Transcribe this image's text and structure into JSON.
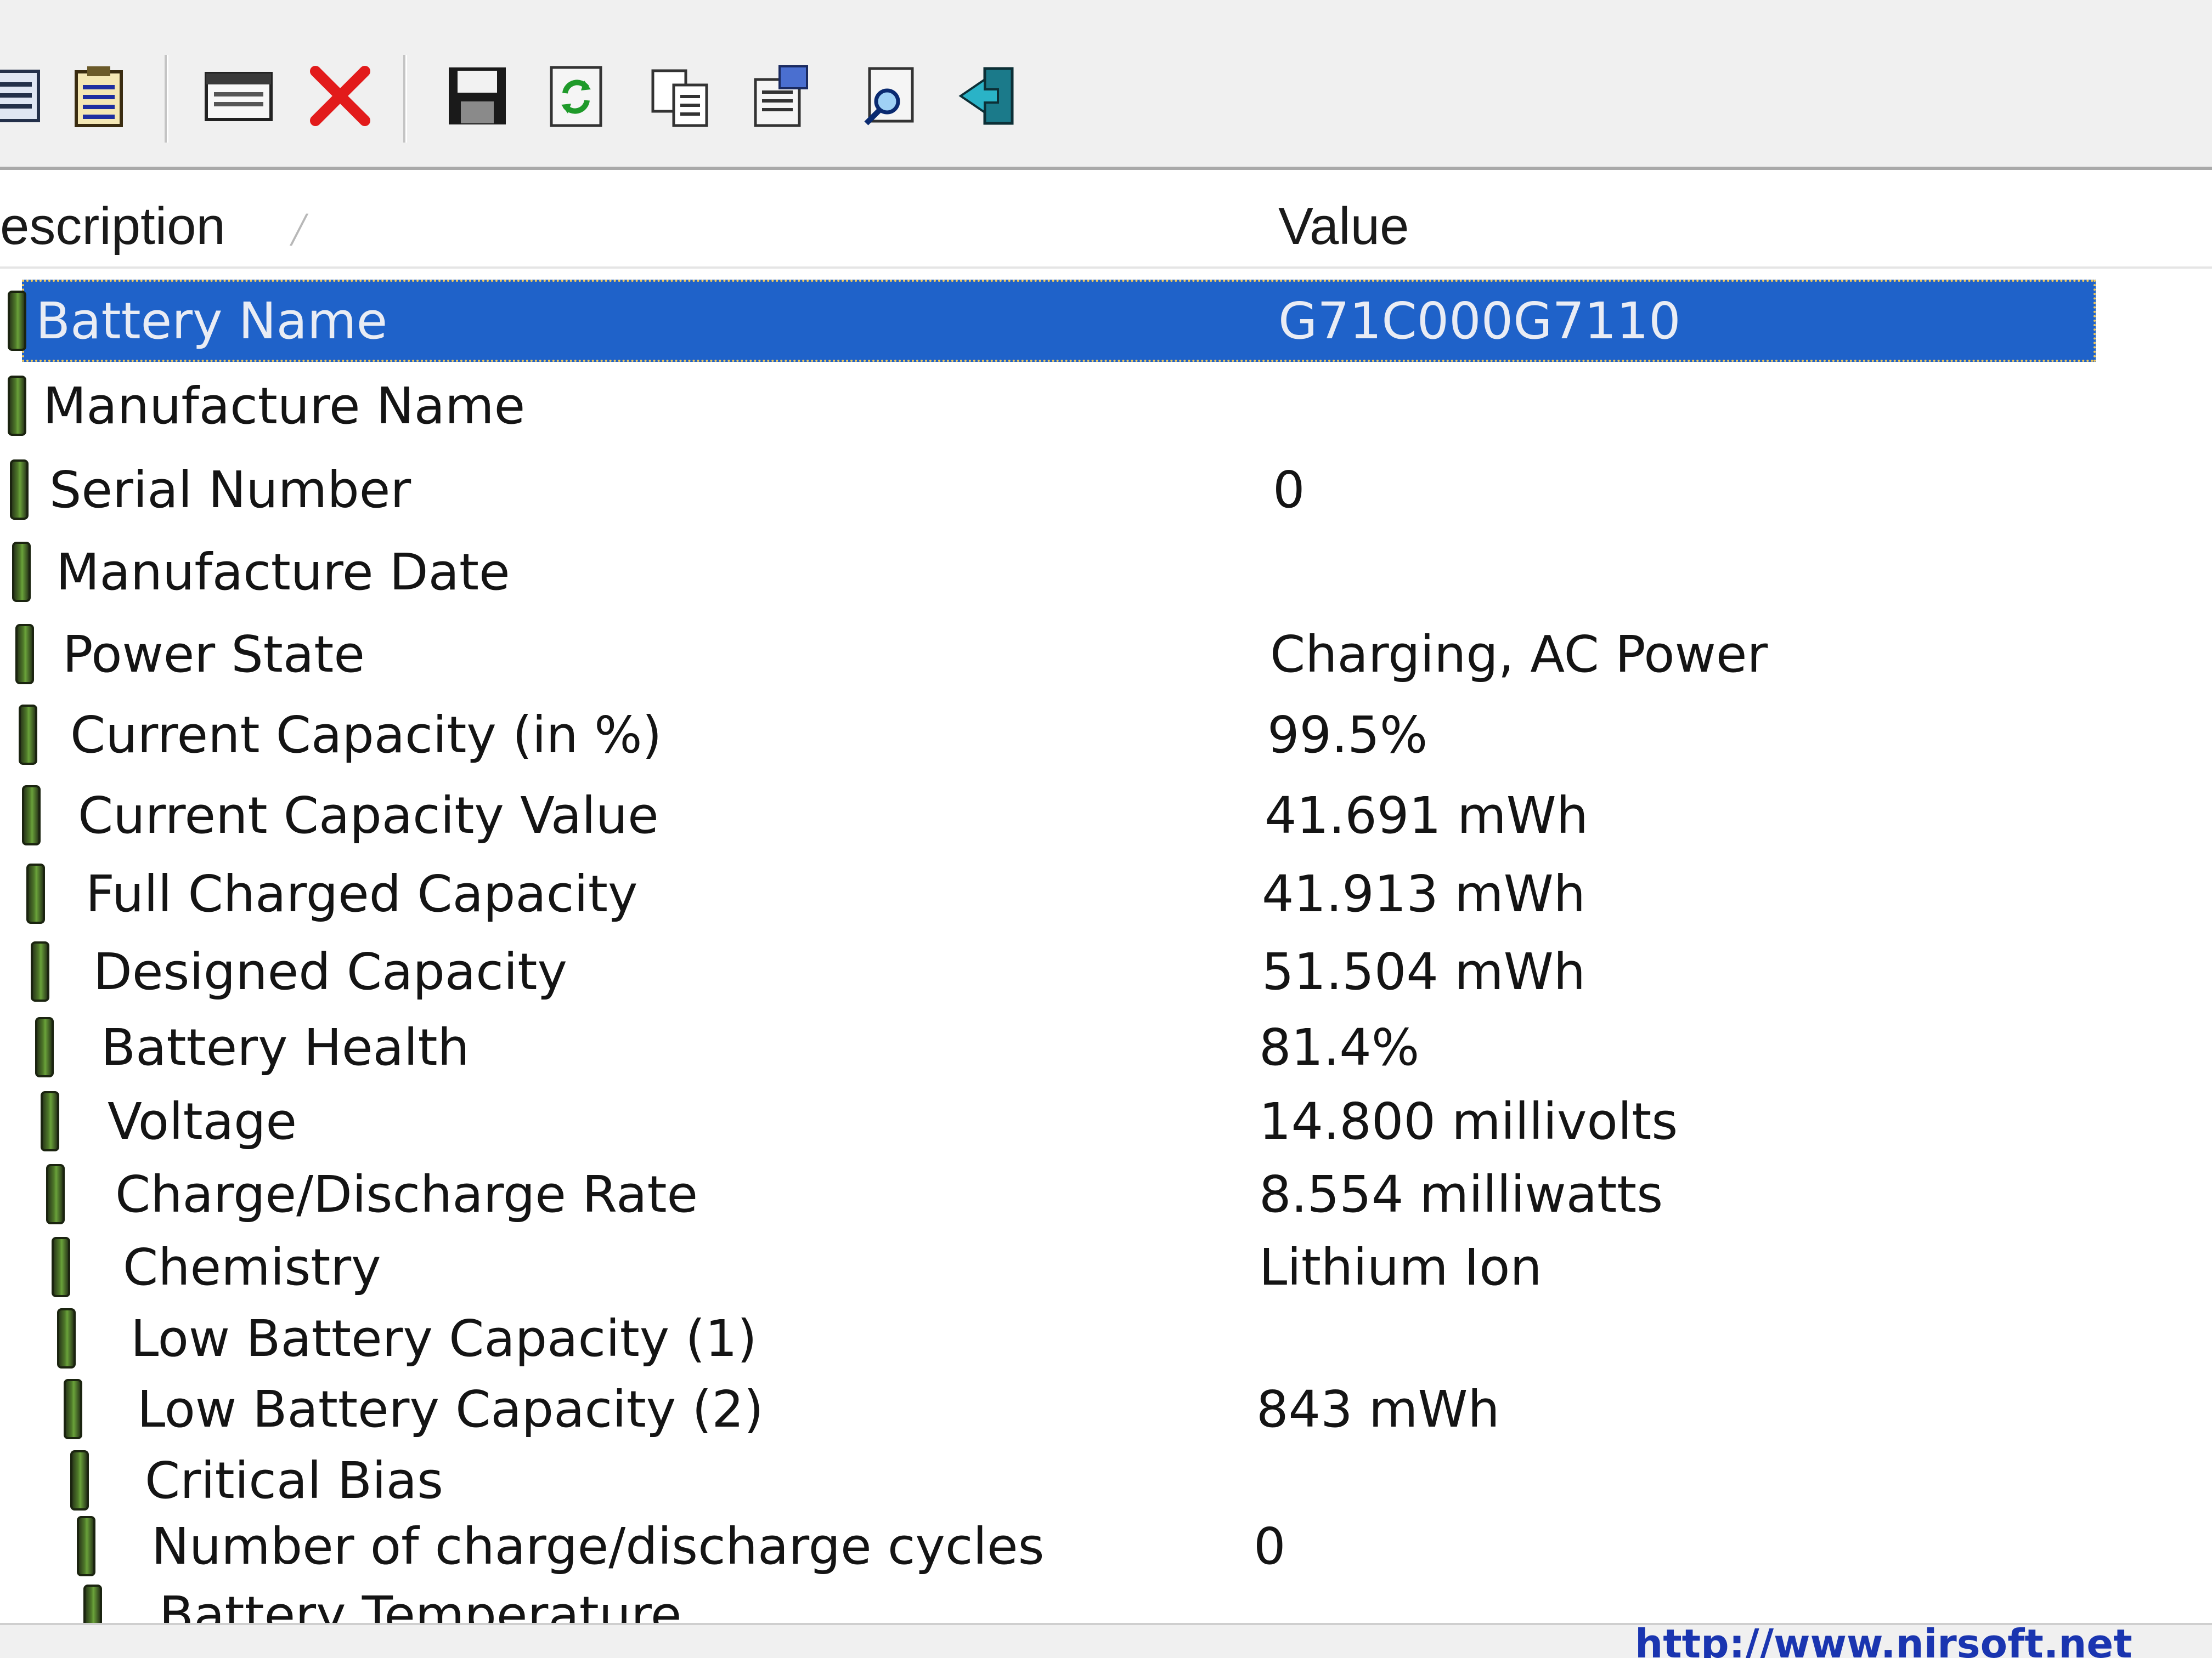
{
  "header": {
    "description_label": "escription",
    "value_label": "Value"
  },
  "toolbar": {
    "buttons": [
      {
        "icon": "properties-icon"
      },
      {
        "icon": "list-icon"
      },
      {
        "icon": "html-report-icon"
      },
      {
        "icon": "delete-icon"
      },
      {
        "icon": "save-icon"
      },
      {
        "icon": "refresh-icon"
      },
      {
        "icon": "copy-icon"
      },
      {
        "icon": "options-icon"
      },
      {
        "icon": "find-icon"
      },
      {
        "icon": "exit-icon"
      }
    ]
  },
  "rows": [
    {
      "label": "Battery Name",
      "value": "G71C000G7110",
      "selected": true
    },
    {
      "label": "Manufacture Name",
      "value": ""
    },
    {
      "label": "Serial Number",
      "value": "0"
    },
    {
      "label": "Manufacture Date",
      "value": ""
    },
    {
      "label": "Power State",
      "value": "Charging, AC Power"
    },
    {
      "label": "Current Capacity (in %)",
      "value": "99.5%"
    },
    {
      "label": "Current Capacity Value",
      "value": "41.691 mWh"
    },
    {
      "label": "Full Charged Capacity",
      "value": "41.913 mWh"
    },
    {
      "label": "Designed Capacity",
      "value": "51.504 mWh"
    },
    {
      "label": "Battery Health",
      "value": "81.4%"
    },
    {
      "label": "Voltage",
      "value": "14.800 millivolts"
    },
    {
      "label": "Charge/Discharge Rate",
      "value": "8.554 milliwatts"
    },
    {
      "label": "Chemistry",
      "value": "Lithium Ion"
    },
    {
      "label": "Low Battery Capacity (1)",
      "value": ""
    },
    {
      "label": "Low Battery Capacity (2)",
      "value": "843 mWh"
    },
    {
      "label": "Critical Bias",
      "value": ""
    },
    {
      "label": "Number of charge/discharge cycles",
      "value": "0"
    },
    {
      "label": "Battery Temperature",
      "value": ""
    }
  ],
  "statusbar": {
    "link_text": "http://www.nirsoft.net"
  },
  "colors": {
    "selection": "#1f62c9",
    "battery_icon": "#4f7a2a",
    "link": "#1a35b0"
  }
}
